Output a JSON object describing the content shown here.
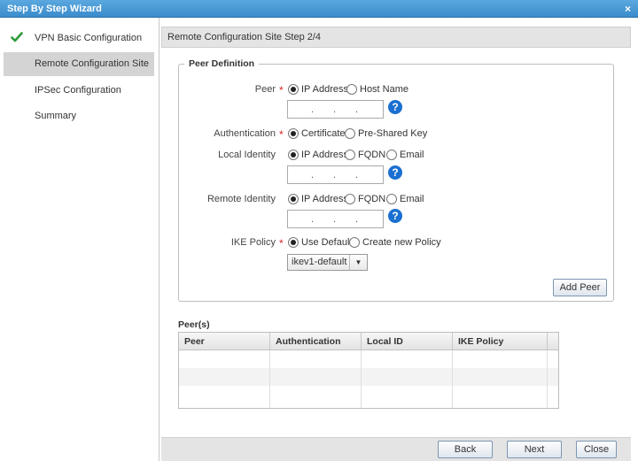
{
  "window": {
    "title": "Step By Step Wizard",
    "close_glyph": "×"
  },
  "sidebar": {
    "items": [
      {
        "label": "VPN Basic Configuration",
        "completed": true
      },
      {
        "label": "Remote Configuration Site",
        "active": true
      },
      {
        "label": "IPSec Configuration"
      },
      {
        "label": "Summary"
      }
    ]
  },
  "header": {
    "title": "Remote Configuration Site  Step 2/4"
  },
  "peer_definition": {
    "legend": "Peer Definition",
    "required_mark": "*",
    "peer": {
      "label": "Peer",
      "options": [
        "IP Address",
        "Host Name"
      ],
      "selected": "IP Address",
      "ip_dots": "."
    },
    "authentication": {
      "label": "Authentication",
      "options": [
        "Certificate",
        "Pre-Shared Key"
      ],
      "selected": "Certificate"
    },
    "local_identity": {
      "label": "Local Identity",
      "options": [
        "IP Address",
        "FQDN",
        "Email"
      ],
      "selected": "IP Address"
    },
    "remote_identity": {
      "label": "Remote Identity",
      "options": [
        "IP Address",
        "FQDN",
        "Email"
      ],
      "selected": "IP Address"
    },
    "ike_policy": {
      "label": "IKE Policy",
      "options": [
        "Use Default",
        "Create new  Policy"
      ],
      "selected": "Use Default",
      "dropdown_value": "ikev1-default"
    },
    "help_glyph": "?",
    "add_button": "Add Peer"
  },
  "peers": {
    "title": "Peer(s)",
    "columns": [
      "Peer",
      "Authentication",
      "Local ID",
      "IKE Policy"
    ],
    "rows": []
  },
  "footer": {
    "back": "Back",
    "next": "Next",
    "close": "Close"
  },
  "colors": {
    "accent": "#3b8ccc",
    "check": "#2e9a3a",
    "required": "#dd2222",
    "help": "#1a6fd1"
  }
}
